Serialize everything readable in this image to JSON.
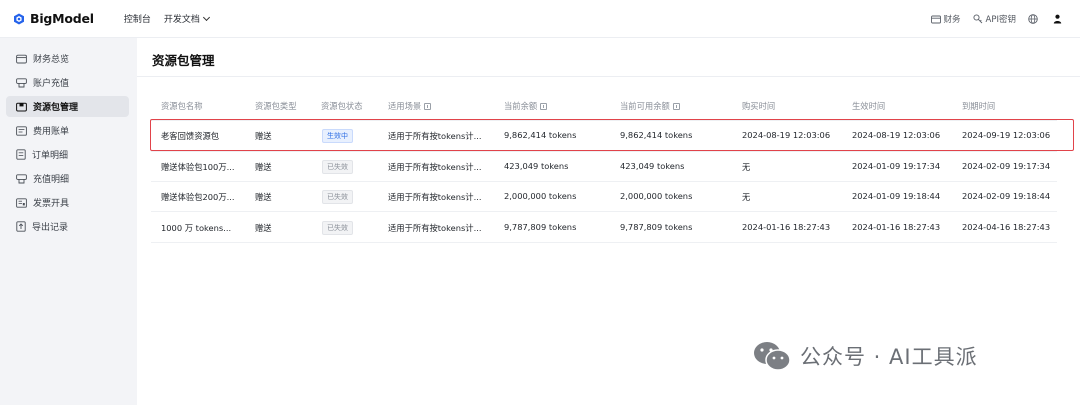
{
  "app": {
    "brand": "BigModel",
    "nav": [
      {
        "label": "控制台"
      },
      {
        "label": "开发文档"
      }
    ],
    "top_right": [
      {
        "label": "财务",
        "icon": "wallet-icon"
      },
      {
        "label": "API密钥",
        "icon": "key-icon"
      }
    ]
  },
  "sidebar": {
    "items": [
      {
        "label": "财务总览",
        "icon": "wallet-icon",
        "active": false
      },
      {
        "label": "账户充值",
        "icon": "recharge-icon",
        "active": false
      },
      {
        "label": "资源包管理",
        "icon": "package-icon",
        "active": true
      },
      {
        "label": "费用账单",
        "icon": "bill-icon",
        "active": false
      },
      {
        "label": "订单明细",
        "icon": "order-icon",
        "active": false
      },
      {
        "label": "充值明细",
        "icon": "recharge-detail-icon",
        "active": false
      },
      {
        "label": "发票开具",
        "icon": "invoice-icon",
        "active": false
      },
      {
        "label": "导出记录",
        "icon": "export-icon",
        "active": false
      }
    ]
  },
  "main": {
    "title": "资源包管理",
    "columns": [
      "资源包名称",
      "资源包类型",
      "资源包状态",
      "适用场景",
      "当前余额",
      "当前可用余额",
      "购买时间",
      "生效时间",
      "到期时间"
    ],
    "rows": [
      {
        "name": "老客回馈资源包",
        "type": "赠送",
        "status": "生效中",
        "status_kind": "active",
        "scene": "适用于所有按tokens计...",
        "balance": "9,862,414 tokens",
        "available": "9,862,414 tokens",
        "bought": "2024-08-19 12:03:06",
        "effective": "2024-08-19 12:03:06",
        "expire": "2024-09-19 12:03:06"
      },
      {
        "name": "赠送体验包100万...",
        "type": "赠送",
        "status": "已失效",
        "status_kind": "expired",
        "scene": "适用于所有按tokens计...",
        "balance": "423,049 tokens",
        "available": "423,049 tokens",
        "bought": "无",
        "effective": "2024-01-09 19:17:34",
        "expire": "2024-02-09 19:17:34"
      },
      {
        "name": "赠送体验包200万...",
        "type": "赠送",
        "status": "已失效",
        "status_kind": "expired",
        "scene": "适用于所有按tokens计...",
        "balance": "2,000,000 tokens",
        "available": "2,000,000 tokens",
        "bought": "无",
        "effective": "2024-01-09 19:18:44",
        "expire": "2024-02-09 19:18:44"
      },
      {
        "name": "1000 万 tokens...",
        "type": "赠送",
        "status": "已失效",
        "status_kind": "expired",
        "scene": "适用于所有按tokens计...",
        "balance": "9,787,809 tokens",
        "available": "9,787,809 tokens",
        "bought": "2024-01-16 18:27:43",
        "effective": "2024-01-16 18:27:43",
        "expire": "2024-04-16 18:27:43"
      }
    ]
  },
  "watermark": {
    "text": "公众号 · AI工具派"
  },
  "colors": {
    "accent": "#2f6fe4",
    "highlight": "#e1434a"
  }
}
